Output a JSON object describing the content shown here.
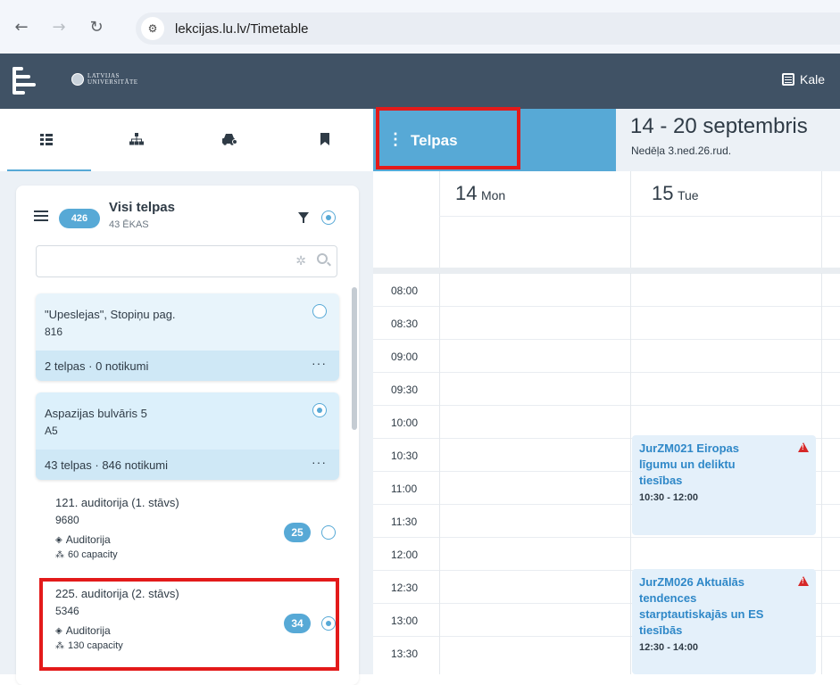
{
  "browser": {
    "url": "lekcijas.lu.lv/Timetable"
  },
  "header": {
    "university_logo_text": "LATVIJAS UNIVERSITĀTE",
    "calendar_label": "Kale"
  },
  "sidebar": {
    "tabs": [
      "list-icon",
      "hierarchy-icon",
      "car-icon",
      "bookmark-icon"
    ],
    "panel": {
      "count": "426",
      "title": "Visi telpas",
      "subtitle": "43 ĒKAS",
      "search_value": ""
    },
    "buildings": [
      {
        "name": "\"Upeslejas\", Stopiņu pag.",
        "code": "816",
        "stats": "2 telpas · 0 notikumi",
        "selected": false
      },
      {
        "name": "Aspazijas bulvāris 5",
        "code": "A5",
        "stats": "43 telpas · 846 notikumi",
        "selected": true
      }
    ],
    "rooms": [
      {
        "name": "121. auditorija (1. stāvs)",
        "code": "9680",
        "type": "Auditorija",
        "capacity": "60 capacity",
        "count": "25",
        "selected": false
      },
      {
        "name": "225. auditorija (2. stāvs)",
        "code": "5346",
        "type": "Auditorija",
        "capacity": "130 capacity",
        "count": "34",
        "selected": true
      }
    ]
  },
  "calendar": {
    "view_button": "Telpas",
    "week_title": "14 - 20 septembris",
    "week_subtitle": "Nedēļa 3.ned.26.rud.",
    "days": [
      {
        "num": "14",
        "name": "Mon"
      },
      {
        "num": "15",
        "name": "Tue"
      }
    ],
    "times": [
      "08:00",
      "08:30",
      "09:00",
      "09:30",
      "10:00",
      "10:30",
      "11:00",
      "11:30",
      "12:00",
      "12:30",
      "13:00",
      "13:30"
    ],
    "events": [
      {
        "title": "JurZM021 Eiropas līgumu un deliktu tiesības",
        "time": "10:30 - 12:00"
      },
      {
        "title": "JurZM026 Aktuālās tendences starptautiskajās un ES tiesībās",
        "time": "12:30 - 14:00"
      }
    ]
  },
  "colors": {
    "accent": "#57a9d6",
    "header_bg": "#405265",
    "highlight": "#e31a1a",
    "warning": "#d62828"
  }
}
